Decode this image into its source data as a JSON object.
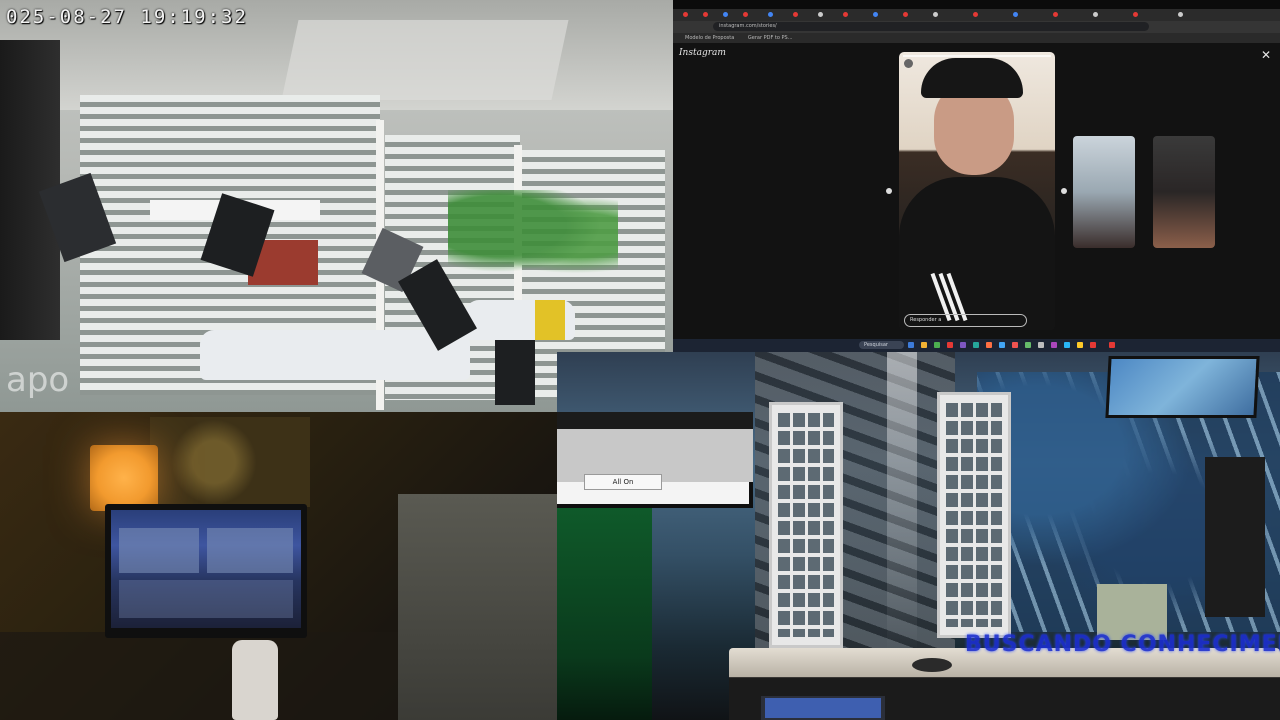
{
  "cameras": {
    "top_left": {
      "timestamp": "025-08-27  19:19:32",
      "watermark": "apo"
    }
  },
  "browser": {
    "url": "instagram.com/stories/",
    "bookmarks": [
      "Modelo de Proposta",
      "Gerar PDF to PS..."
    ],
    "site_logo": "Instagram",
    "close_icon": "close-icon",
    "story": {
      "reply_placeholder": "Responder a"
    },
    "taskbar": {
      "search_label": "Pesquisar"
    }
  },
  "dialog": {
    "button_label": "All On"
  },
  "overlay": {
    "caption": "BUSCANDO CONHECIMENTO"
  },
  "colors": {
    "overlay_text": "#1c2fd0",
    "lamp": "#f29a2e",
    "taskbar": "#1c2433"
  }
}
